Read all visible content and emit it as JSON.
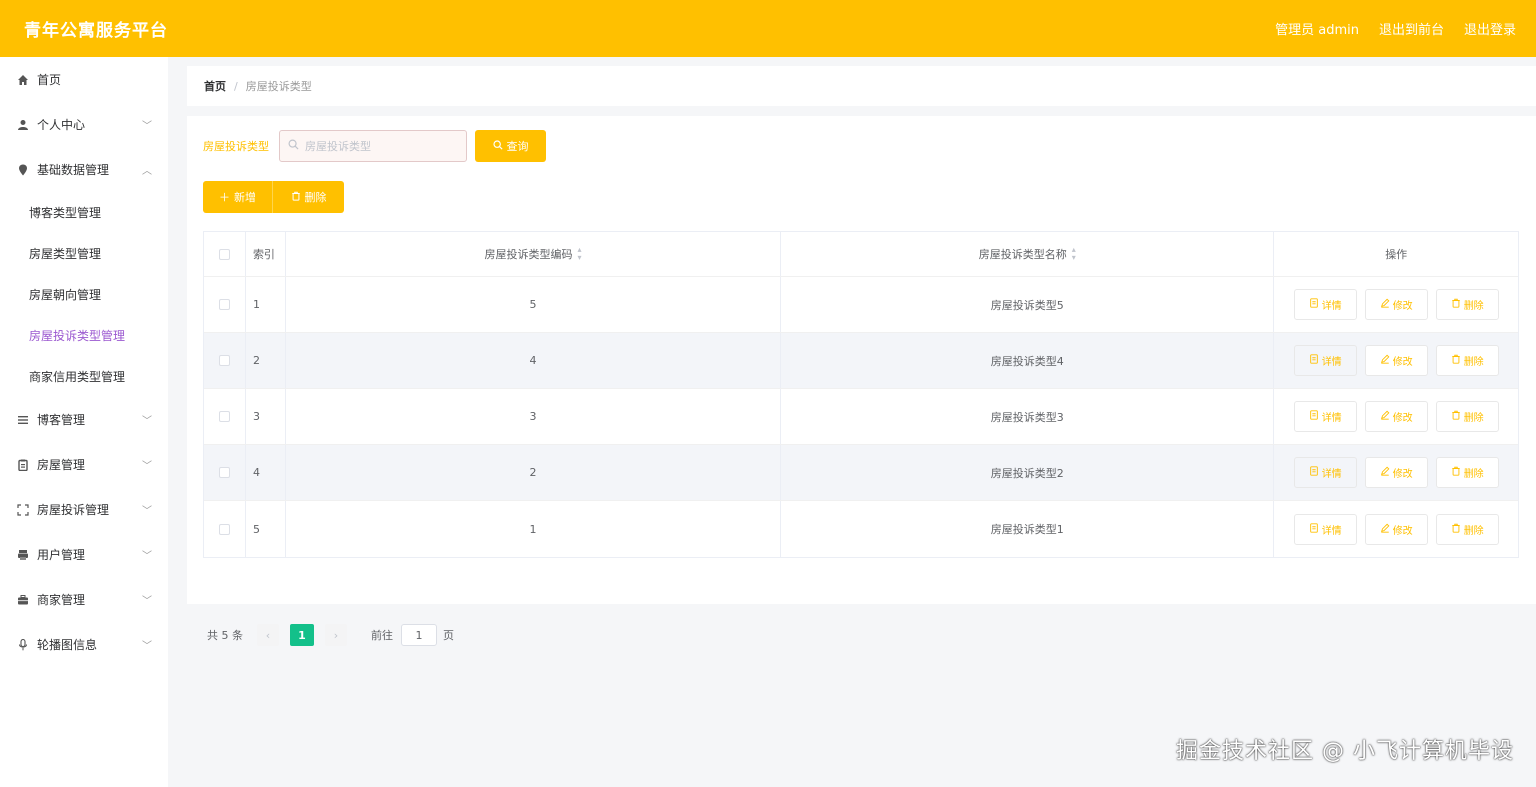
{
  "header": {
    "title": "青年公寓服务平台",
    "user_label": "管理员 admin",
    "back_to_front": "退出到前台",
    "logout": "退出登录",
    "bg_color": "#ffc000"
  },
  "sidebar": {
    "menus": [
      {
        "label": "首页",
        "icon": "home-icon"
      },
      {
        "label": "个人中心",
        "icon": "user-icon"
      },
      {
        "label": "基础数据管理",
        "icon": "location-icon",
        "expanded": true,
        "children": [
          "博客类型管理",
          "房屋类型管理",
          "房屋朝向管理",
          "房屋投诉类型管理",
          "商家信用类型管理"
        ],
        "active_child": "房屋投诉类型管理"
      },
      {
        "label": "博客管理",
        "icon": "list-icon"
      },
      {
        "label": "房屋管理",
        "icon": "clipboard-icon"
      },
      {
        "label": "房屋投诉管理",
        "icon": "fullscreen-icon"
      },
      {
        "label": "用户管理",
        "icon": "printer-icon"
      },
      {
        "label": "商家管理",
        "icon": "suitcase-icon"
      },
      {
        "label": "轮播图信息",
        "icon": "microphone-icon"
      }
    ],
    "active_color": "#9b59d0"
  },
  "breadcrumb": {
    "home": "首页",
    "separator": "/",
    "current": "房屋投诉类型"
  },
  "search": {
    "label": "房屋投诉类型",
    "placeholder": "房屋投诉类型",
    "query_button": "查询"
  },
  "actions": {
    "add": "新增",
    "delete": "删除"
  },
  "table": {
    "columns": [
      "索引",
      "房屋投诉类型编码",
      "房屋投诉类型名称",
      "操作"
    ],
    "rows": [
      {
        "index": "1",
        "code": "5",
        "name": "房屋投诉类型5"
      },
      {
        "index": "2",
        "code": "4",
        "name": "房屋投诉类型4"
      },
      {
        "index": "3",
        "code": "3",
        "name": "房屋投诉类型3"
      },
      {
        "index": "4",
        "code": "2",
        "name": "房屋投诉类型2"
      },
      {
        "index": "5",
        "code": "1",
        "name": "房屋投诉类型1"
      }
    ],
    "row_buttons": {
      "detail": "详情",
      "edit": "修改",
      "delete": "删除"
    }
  },
  "pagination": {
    "total": "共 5 条",
    "current_page": "1",
    "goto_label": "前往",
    "goto_value": "1",
    "unit": "页",
    "active_color": "#13c08a"
  },
  "watermark": "掘金技术社区 @ 小飞计算机毕设"
}
